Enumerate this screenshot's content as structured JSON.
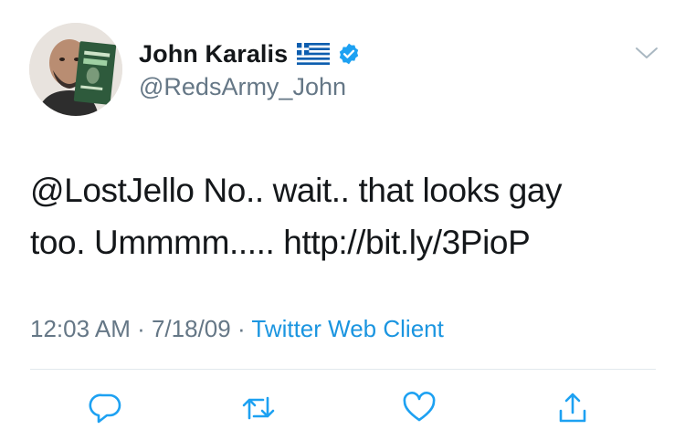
{
  "author": {
    "display_name": "John Karalis",
    "handle": "@RedsArmy_John",
    "flag_icon": "greece-flag-icon",
    "verified_icon": "verified-badge-icon",
    "verified_color": "#1da1f2"
  },
  "tweet": {
    "text_line1": "@LostJello No.. wait.. that looks gay",
    "text_line2_prefix": "too.  Ummmm.....",
    "link": "http://bit.ly/3PioP"
  },
  "meta": {
    "time": "12:03 AM",
    "sep1": " · ",
    "date": "7/18/09",
    "sep2": " · ",
    "source": "Twitter Web Client"
  },
  "actions": [
    {
      "name": "reply",
      "icon": "reply-icon"
    },
    {
      "name": "retweet",
      "icon": "retweet-icon"
    },
    {
      "name": "like",
      "icon": "heart-icon"
    },
    {
      "name": "share",
      "icon": "share-icon"
    }
  ],
  "colors": {
    "text": "#14171a",
    "secondary": "#657786",
    "link": "#1b95e0",
    "icon": "#1da1f2",
    "divider": "#e1e8ed"
  }
}
